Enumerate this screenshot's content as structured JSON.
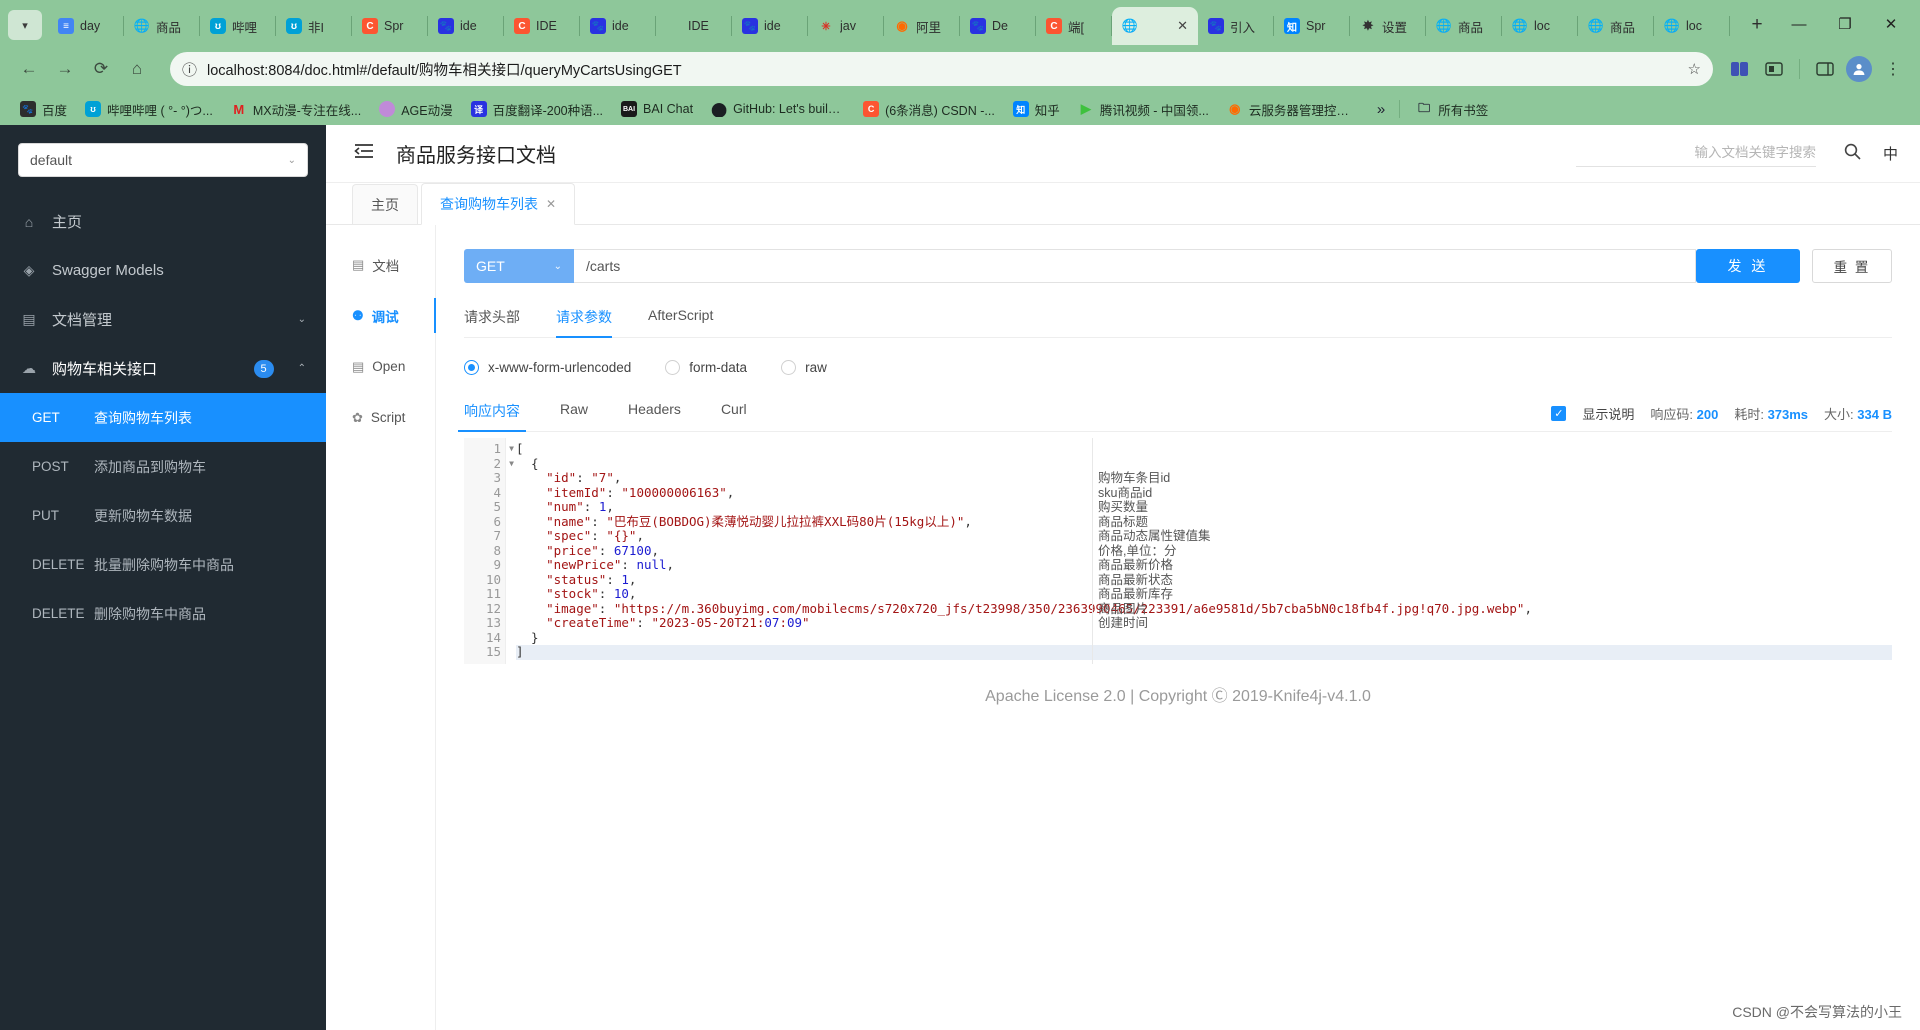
{
  "browser": {
    "tabs": [
      {
        "label": "day",
        "fav": "doc",
        "color": "#4285f4"
      },
      {
        "label": "商品",
        "fav": "globe",
        "color": "#8a8a8a"
      },
      {
        "label": "哔哩",
        "fav": "bili",
        "color": "#00a1d6"
      },
      {
        "label": "非I",
        "fav": "bili",
        "color": "#00a1d6"
      },
      {
        "label": "Spr",
        "fav": "csdn",
        "color": "#fc5531"
      },
      {
        "label": "ide",
        "fav": "baidu",
        "color": "#2932e1"
      },
      {
        "label": "IDE",
        "fav": "csdn",
        "color": "#fc5531"
      },
      {
        "label": "ide",
        "fav": "baidu",
        "color": "#2932e1"
      },
      {
        "label": "IDE",
        "fav": "none",
        "color": "#8a8a8a"
      },
      {
        "label": "ide",
        "fav": "baidu",
        "color": "#2932e1"
      },
      {
        "label": "jav",
        "fav": "spark",
        "color": "#d93025"
      },
      {
        "label": "阿里",
        "fav": "ali",
        "color": "#ff6a00"
      },
      {
        "label": "De",
        "fav": "baidu",
        "color": "#2932e1"
      },
      {
        "label": "端[",
        "fav": "csdn",
        "color": "#fc5531"
      },
      {
        "label": "",
        "fav": "globe",
        "color": "#8a8a8a",
        "active": true,
        "close": "✕"
      },
      {
        "label": "引入",
        "fav": "baidu",
        "color": "#2932e1"
      },
      {
        "label": "Spr",
        "fav": "zhihu",
        "color": "#0084ff"
      },
      {
        "label": "设置",
        "fav": "gear",
        "color": "#333333"
      },
      {
        "label": "商品",
        "fav": "globe",
        "color": "#8a8a8a"
      },
      {
        "label": "loc",
        "fav": "globe",
        "color": "#8a8a8a"
      },
      {
        "label": "商品",
        "fav": "globe",
        "color": "#8a8a8a"
      },
      {
        "label": "loc",
        "fav": "globe",
        "color": "#8a8a8a"
      }
    ],
    "new_tab": "+",
    "window_controls": {
      "minimize": "—",
      "maximize": "❐",
      "close": "✕"
    },
    "nav": {
      "back": "←",
      "forward": "→",
      "reload": "⟳",
      "home": "⌂"
    },
    "url": "localhost:8084/doc.html#/default/购物车相关接口/queryMyCartsUsingGET",
    "info_icon": "ⓘ",
    "star_icon": "☆",
    "profile_initial": "",
    "bookmarks": [
      {
        "label": "百度",
        "fav": "baidu-g",
        "color": "#2d2d2d"
      },
      {
        "label": "哔哩哔哩 ( °- °)つ...",
        "fav": "bili",
        "color": "#00a1d6"
      },
      {
        "label": "MX动漫-专注在线...",
        "fav": "mx",
        "color": "#e02020"
      },
      {
        "label": "AGE动漫",
        "fav": "age",
        "color": "#c08ad8"
      },
      {
        "label": "百度翻译-200种语...",
        "fav": "fanyi",
        "color": "#2932e1"
      },
      {
        "label": "BAI Chat",
        "fav": "bai",
        "color": "#1a1a1a"
      },
      {
        "label": "GitHub: Let's build...",
        "fav": "github",
        "color": "#1b1f23"
      },
      {
        "label": "(6条消息) CSDN -...",
        "fav": "csdn",
        "color": "#fc5531"
      },
      {
        "label": "知乎",
        "fav": "zhihu",
        "color": "#0084ff"
      },
      {
        "label": "腾讯视频 - 中国领...",
        "fav": "tencent",
        "color": "#3ec13e"
      },
      {
        "label": "云服务器管理控制台",
        "fav": "aliyun",
        "color": "#ff6a00"
      }
    ],
    "bookmarks_overflow": "»",
    "all_bookmarks": "所有书签",
    "all_bookmarks_icon": "folder-icon"
  },
  "sidebar": {
    "selector_value": "default",
    "selector_caret": "⌄",
    "nav": [
      {
        "label": "主页",
        "icon": "home-icon"
      },
      {
        "label": "Swagger Models",
        "icon": "cube-icon"
      },
      {
        "label": "文档管理",
        "icon": "doc-settings-icon",
        "caret": "⌄"
      },
      {
        "label": "购物车相关接口",
        "icon": "cloud-icon",
        "badge": "5",
        "caret": "⌃",
        "open": true
      }
    ],
    "apis": [
      {
        "method": "GET",
        "label": "查询购物车列表",
        "active": true
      },
      {
        "method": "POST",
        "label": "添加商品到购物车",
        "active": false
      },
      {
        "method": "PUT",
        "label": "更新购物车数据",
        "active": false
      },
      {
        "method": "DELETE",
        "label": "批量删除购物车中商品",
        "active": false
      },
      {
        "method": "DELETE",
        "label": "删除购物车中商品",
        "active": false
      }
    ]
  },
  "header": {
    "hamburger_icon": "collapse-menu-icon",
    "title": "商品服务接口文档",
    "search_placeholder": "输入文档关键字搜索",
    "search_icon": "search-icon",
    "lang": "中"
  },
  "page_tabs": [
    {
      "label": "主页",
      "active": false,
      "closable": false
    },
    {
      "label": "查询购物车列表",
      "active": true,
      "closable": true,
      "close": "✕"
    }
  ],
  "left_rail": [
    {
      "label": "文档",
      "icon": "document-icon",
      "active": false
    },
    {
      "label": "调试",
      "icon": "bug-icon",
      "active": true
    },
    {
      "label": "Open",
      "icon": "open-icon",
      "active": false
    },
    {
      "label": "Script",
      "icon": "script-icon",
      "active": false
    }
  ],
  "request": {
    "method": "GET",
    "method_caret": "⌄",
    "url": "/carts",
    "send_label": "发 送",
    "reset_label": "重 置",
    "tabs": [
      {
        "label": "请求头部",
        "active": false
      },
      {
        "label": "请求参数",
        "active": true
      },
      {
        "label": "AfterScript",
        "active": false
      }
    ],
    "body_types": [
      {
        "label": "x-www-form-urlencoded",
        "selected": true
      },
      {
        "label": "form-data",
        "selected": false
      },
      {
        "label": "raw",
        "selected": false
      }
    ]
  },
  "response": {
    "tabs": [
      {
        "label": "响应内容",
        "active": true
      },
      {
        "label": "Raw",
        "active": false
      },
      {
        "label": "Headers",
        "active": false
      },
      {
        "label": "Curl",
        "active": false
      }
    ],
    "show_desc_label": "显示说明",
    "show_desc_checked": true,
    "status_key": "响应码:",
    "status_value": "200",
    "time_key": "耗时:",
    "time_value": "373ms",
    "size_key": "大小:",
    "size_value": "334 B",
    "code_lines": [
      {
        "n": 1,
        "fold": true,
        "html": "[",
        "hl": false,
        "desc": ""
      },
      {
        "n": 2,
        "fold": true,
        "html": "  {",
        "hl": false,
        "desc": ""
      },
      {
        "n": 3,
        "fold": false,
        "html": "    \"id\": \"7\",",
        "hl": false,
        "desc": "购物车条目id"
      },
      {
        "n": 4,
        "fold": false,
        "html": "    \"itemId\": \"100000006163\",",
        "hl": false,
        "desc": "sku商品id"
      },
      {
        "n": 5,
        "fold": false,
        "html": "    \"num\": 1,",
        "hl": false,
        "desc": "购买数量"
      },
      {
        "n": 6,
        "fold": false,
        "html": "    \"name\": \"巴布豆(BOBDOG)柔薄悦动婴儿拉拉裤XXL码80片(15kg以上)\",",
        "hl": false,
        "desc": "商品标题"
      },
      {
        "n": 7,
        "fold": false,
        "html": "    \"spec\": \"{}\",",
        "hl": false,
        "desc": "商品动态属性键值集"
      },
      {
        "n": 8,
        "fold": false,
        "html": "    \"price\": 67100,",
        "hl": false,
        "desc": "价格,单位：分"
      },
      {
        "n": 9,
        "fold": false,
        "html": "    \"newPrice\": null,",
        "hl": false,
        "desc": "商品最新价格"
      },
      {
        "n": 10,
        "fold": false,
        "html": "    \"status\": 1,",
        "hl": false,
        "desc": "商品最新状态"
      },
      {
        "n": 11,
        "fold": false,
        "html": "    \"stock\": 10,",
        "hl": false,
        "desc": "商品最新库存"
      },
      {
        "n": 12,
        "fold": false,
        "html": "    \"image\": \"https://m.360buyimg.com/mobilecms/s720x720_jfs/t23998/350/2363990465/223391/a6e9581d/5b7cba5bN0c18fb4f.jpg!q70.jpg.webp\",",
        "hl": false,
        "desc": "商品图片"
      },
      {
        "n": 13,
        "fold": false,
        "html": "    \"createTime\": \"2023-05-20T21:07:09\"",
        "hl": false,
        "desc": "创建时间"
      },
      {
        "n": 14,
        "fold": false,
        "html": "  }",
        "hl": false,
        "desc": ""
      },
      {
        "n": 15,
        "fold": false,
        "html": "]",
        "hl": true,
        "desc": ""
      }
    ]
  },
  "footer": "Apache License 2.0 | Copyright Ⓒ 2019-Knife4j-v4.1.0",
  "watermark": "CSDN @不会写算法的小王",
  "colors": {
    "accent": "#1890ff",
    "chrome_green": "#8ec79a",
    "sidebar_dark": "#202a32",
    "method_get": "#6eaef5"
  }
}
